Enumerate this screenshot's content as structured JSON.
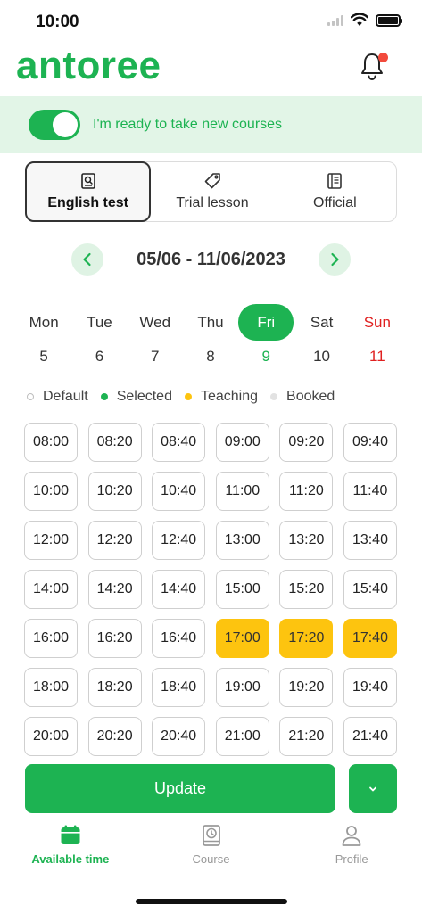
{
  "status_bar": {
    "time": "10:00"
  },
  "header": {
    "logo": "antoree",
    "bell_icon": "bell-icon",
    "has_notification": true
  },
  "ready_banner": {
    "toggle_on": true,
    "text": "I'm ready to take new courses"
  },
  "tabs": [
    {
      "label": "English test",
      "icon": "search-document-icon",
      "active": true
    },
    {
      "label": "Trial lesson",
      "icon": "tag-icon",
      "active": false
    },
    {
      "label": "Official",
      "icon": "notebook-icon",
      "active": false
    }
  ],
  "week": {
    "range": "05/06 - 11/06/2023"
  },
  "days": [
    {
      "name": "Mon",
      "num": "5"
    },
    {
      "name": "Tue",
      "num": "6"
    },
    {
      "name": "Wed",
      "num": "7"
    },
    {
      "name": "Thu",
      "num": "8"
    },
    {
      "name": "Fri",
      "num": "9",
      "selected": true
    },
    {
      "name": "Sat",
      "num": "10"
    },
    {
      "name": "Sun",
      "num": "11",
      "weekend": true
    }
  ],
  "legend": [
    {
      "label": "Default",
      "color": "#ffffff"
    },
    {
      "label": "Selected",
      "color": "#1db352"
    },
    {
      "label": "Teaching",
      "color": "#fdc40f"
    },
    {
      "label": "Booked",
      "color": "#e2e2e2"
    }
  ],
  "slots": [
    "08:00",
    "08:20",
    "08:40",
    "09:00",
    "09:20",
    "09:40",
    "10:00",
    "10:20",
    "10:40",
    "11:00",
    "11:20",
    "11:40",
    "12:00",
    "12:20",
    "12:40",
    "13:00",
    "13:20",
    "13:40",
    "14:00",
    "14:20",
    "14:40",
    "15:00",
    "15:20",
    "15:40",
    "16:00",
    "16:20",
    "16:40",
    "17:00",
    "17:20",
    "17:40",
    "18:00",
    "18:20",
    "18:40",
    "19:00",
    "19:20",
    "19:40",
    "20:00",
    "20:20",
    "20:40",
    "21:00",
    "21:20",
    "21:40"
  ],
  "teaching_slots": [
    "17:00",
    "17:20",
    "17:40"
  ],
  "actions": {
    "update_label": "Update",
    "more_icon": "chevron-down-icon"
  },
  "bottom_nav": [
    {
      "label": "Available time",
      "icon": "calendar-icon",
      "active": true
    },
    {
      "label": "Course",
      "icon": "book-clock-icon",
      "active": false
    },
    {
      "label": "Profile",
      "icon": "user-icon",
      "active": false
    }
  ],
  "colors": {
    "brand": "#1db352",
    "teaching": "#fdc40f",
    "sunday": "#e02020",
    "banner_bg": "#e2f5e7"
  }
}
